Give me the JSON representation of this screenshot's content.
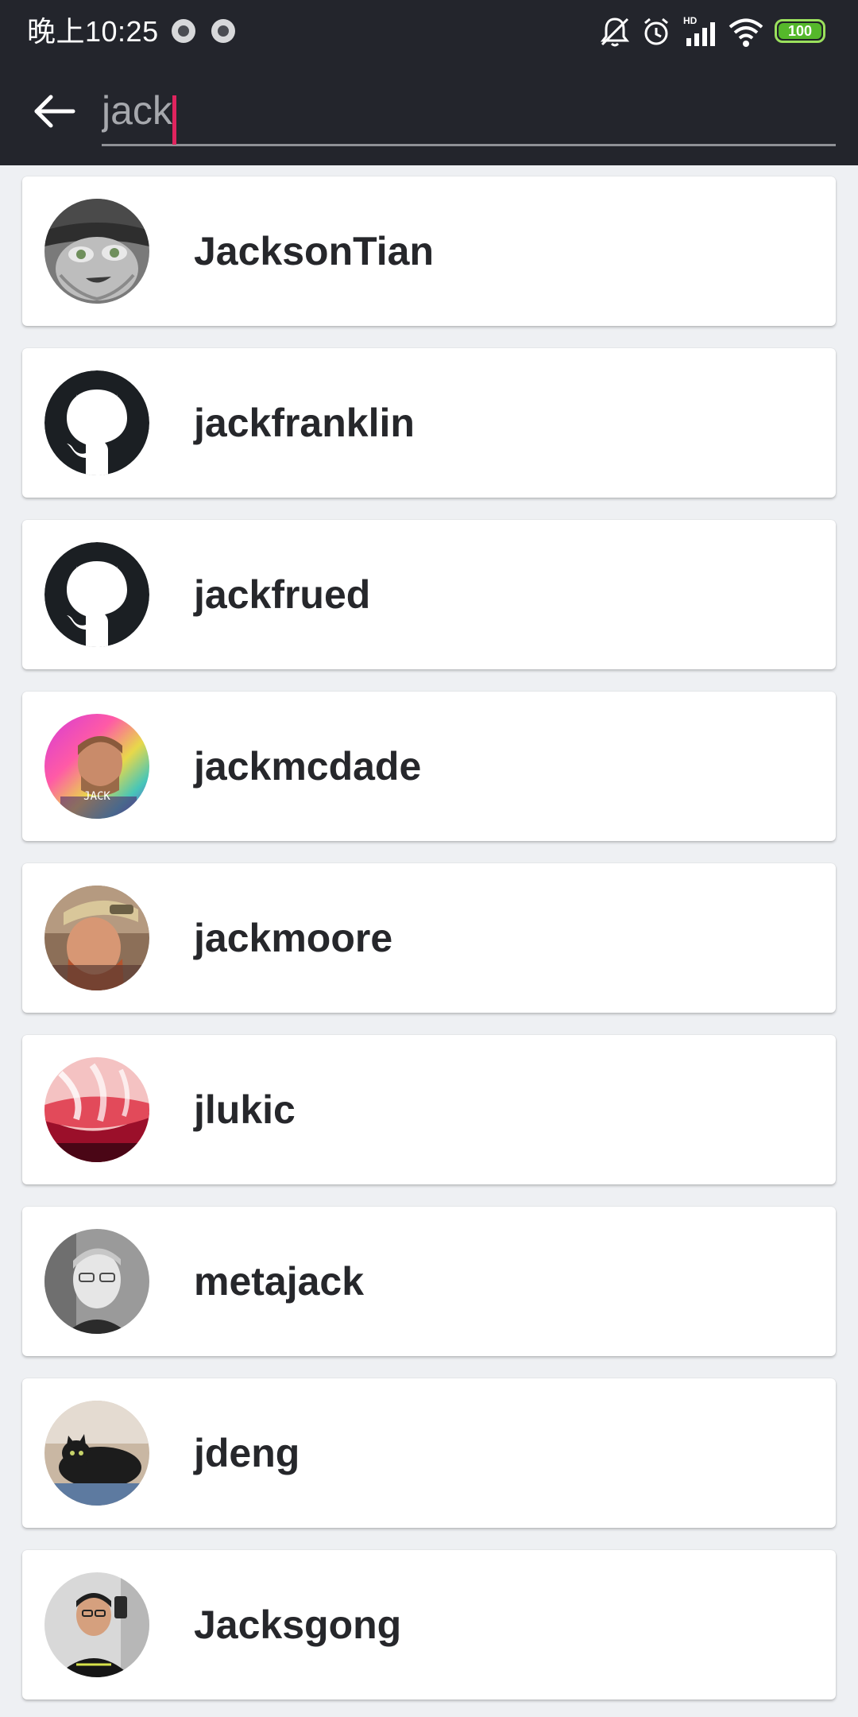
{
  "status_bar": {
    "time": "晚上10:25",
    "battery_level": "100",
    "battery_color": "#55b82b",
    "icons": [
      "notification-dot-icon",
      "notification-dot-icon",
      "muted-bell-icon",
      "alarm-icon",
      "hd-signal-icon",
      "wifi-icon",
      "battery-icon"
    ]
  },
  "search": {
    "value": "jack",
    "back_icon": "arrow-left-icon",
    "caret_color": "#e0245e"
  },
  "results": [
    {
      "username": "JacksonTian",
      "avatar": "cartoon-cat-avatar"
    },
    {
      "username": "jackfranklin",
      "avatar": "github-octocat-icon"
    },
    {
      "username": "jackfrued",
      "avatar": "github-octocat-icon"
    },
    {
      "username": "jackmcdade",
      "avatar": "photo-avatar",
      "avatar_caption": "JACK"
    },
    {
      "username": "jackmoore",
      "avatar": "photo-avatar"
    },
    {
      "username": "jlukic",
      "avatar": "abstract-red-avatar"
    },
    {
      "username": "metajack",
      "avatar": "photo-avatar"
    },
    {
      "username": "jdeng",
      "avatar": "cat-photo-avatar"
    },
    {
      "username": "Jacksgong",
      "avatar": "photo-avatar"
    }
  ],
  "colors": {
    "header_background": "#23252c",
    "list_background": "#eef0f3",
    "card_background": "#ffffff",
    "username_text": "#26272b"
  }
}
